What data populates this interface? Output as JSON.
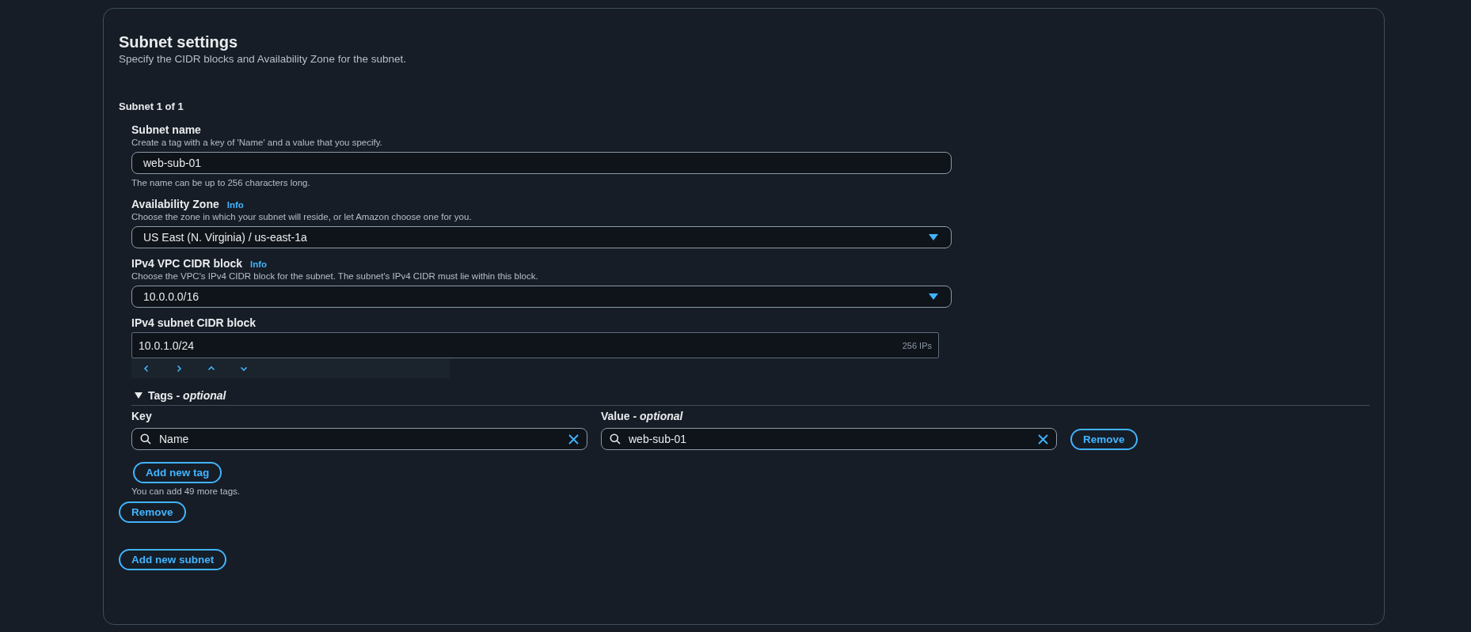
{
  "section": {
    "title": "Subnet settings",
    "description": "Specify the CIDR blocks and Availability Zone for the subnet."
  },
  "subnet": {
    "heading": "Subnet 1 of 1",
    "fields": [
      {
        "kind": "text",
        "label": "Subnet name",
        "description": "Create a tag with a key of 'Name' and a value that you specify.",
        "value": "web-sub-01",
        "constraint": "The name can be up to 256 characters long."
      },
      {
        "kind": "select",
        "label": "Availability Zone",
        "info": "Info",
        "description": "Choose the zone in which your subnet will reside, or let Amazon choose one for you.",
        "value": "US East (N. Virginia) / us-east-1a"
      },
      {
        "kind": "select",
        "label": "IPv4 VPC CIDR block",
        "info": "Info",
        "description": "Choose the VPC's IPv4 CIDR block for the subnet. The subnet's IPv4 CIDR must lie within this block.",
        "value": "10.0.0.0/16"
      },
      {
        "kind": "cidr",
        "label": "IPv4 subnet CIDR block",
        "value": "10.0.1.0/24",
        "suffix": "256 IPs"
      }
    ],
    "tags": {
      "title": "Tags - *optional*",
      "expanded": true,
      "key_label": "Key",
      "value_label": "Value - *optional*",
      "rows": [
        {
          "key": "Name",
          "value": "web-sub-01",
          "remove": "Remove"
        }
      ],
      "add_button": "Add new tag",
      "hint": "You can add 49 more tags."
    },
    "remove_button": "Remove"
  },
  "add_subnet_button": "Add new subnet"
}
